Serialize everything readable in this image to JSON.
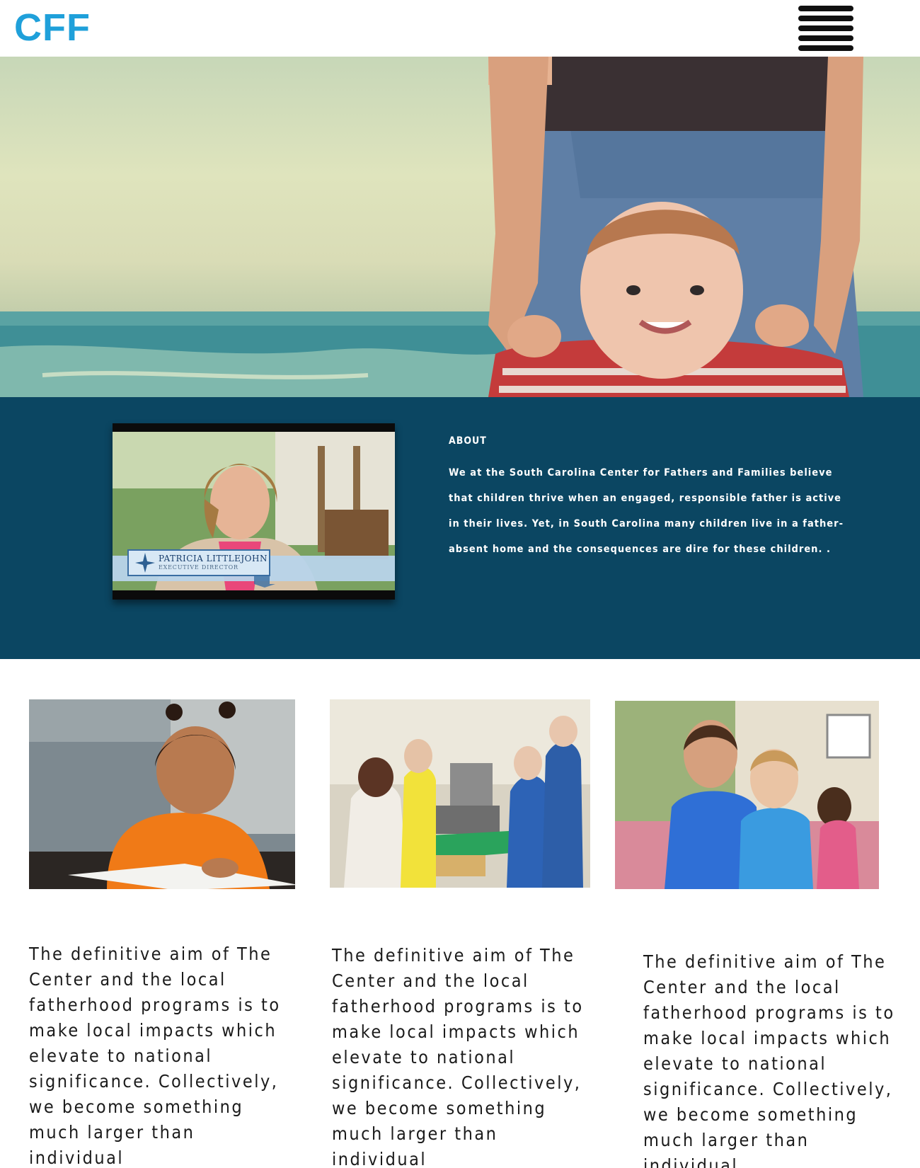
{
  "header": {
    "logo_text": "CFF",
    "brand_color": "#1fa0da",
    "menu_icon": "hamburger-list-icon"
  },
  "hero": {
    "image": "parent-holding-smiling-toddler-at-beach"
  },
  "about": {
    "heading": "ABOUT",
    "body": "We at the South Carolina Center for Fathers and Families believe that children thrive when an engaged, responsible father is active in their lives. Yet, in South Carolina many children live in a father-absent home and the consequences are dire for these children. .",
    "band_color": "#0b4662",
    "video": {
      "name": "PATRICIA LITTLEJOHN",
      "title": "EXECUTIVE DIRECTOR"
    }
  },
  "cards": [
    {
      "image": "girl-writing-at-desk",
      "text": "The definitive aim of The Center and the local fatherhood programs is to make local impacts which elevate to national significance. Collectively, we become something much larger than individual"
    },
    {
      "image": "women-cooking-in-kitchen",
      "text": "The definitive aim of The Center and the local fatherhood programs is to make local impacts which elevate to national significance. Collectively, we become something much larger than individual"
    },
    {
      "image": "two-boys-smiling-outdoors",
      "text": "The definitive aim of The Center and the local fatherhood programs is to make local impacts which elevate to national significance. Collectively, we become something much larger than individual"
    }
  ]
}
